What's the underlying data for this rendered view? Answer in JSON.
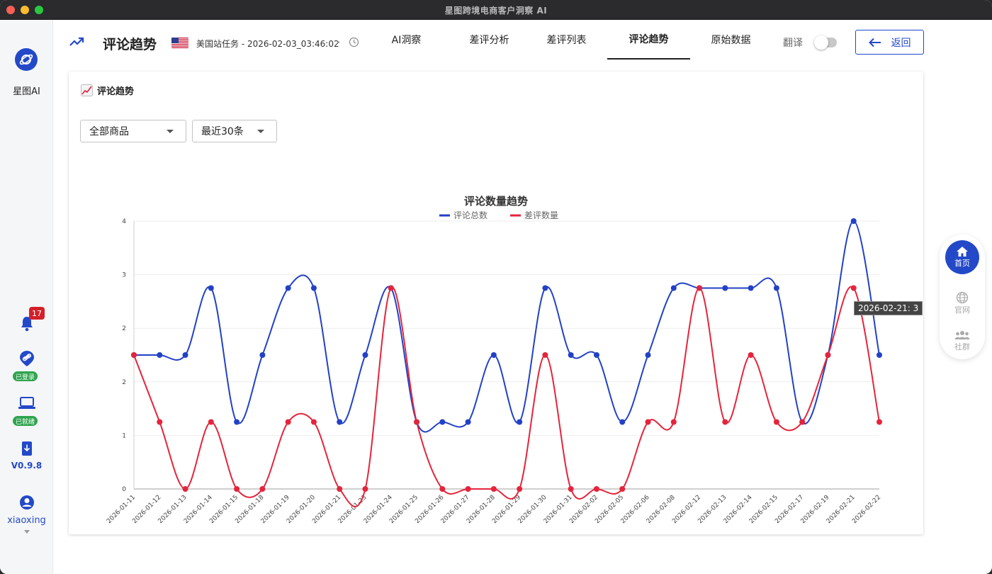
{
  "window": {
    "title": "星图跨境电商客户洞察 AI"
  },
  "sidebar": {
    "brand": "星图AI",
    "notifications": "17",
    "login_status": "已登录",
    "ready_status": "已就绪",
    "version": "V0.9.8",
    "user": "xiaoxing"
  },
  "header": {
    "title": "评论趋势",
    "task": "美国站任务 - 2026-02-03_03:46:02",
    "tabs": [
      {
        "label": "AI洞察",
        "active": false
      },
      {
        "label": "差评分析",
        "active": false
      },
      {
        "label": "差评列表",
        "active": false
      },
      {
        "label": "评论趋势",
        "active": true
      },
      {
        "label": "原始数据",
        "active": false
      }
    ],
    "translate_label": "翻译",
    "translate_on": false,
    "back_label": "返回"
  },
  "card": {
    "title": "评论趋势",
    "product_filter": "全部商品",
    "range_filter": "最近30条"
  },
  "float_panel": {
    "home": "首页",
    "official": "官网",
    "community": "社群"
  },
  "tooltip": "2026-02-21: 3",
  "colors": {
    "accent": "#2349c8",
    "total": "#2241c7",
    "negative": "#e5243b"
  },
  "chart_data": {
    "type": "line",
    "title": "评论数量趋势",
    "categories": [
      "2026-01-11",
      "2026-01-12",
      "2026-01-13",
      "2026-01-14",
      "2026-01-15",
      "2026-01-18",
      "2026-01-19",
      "2026-01-20",
      "2026-01-21",
      "2026-01-23",
      "2026-01-24",
      "2026-01-25",
      "2026-01-26",
      "2026-01-27",
      "2026-01-28",
      "2026-01-29",
      "2026-01-30",
      "2026-01-31",
      "2026-02-02",
      "2026-02-05",
      "2026-02-06",
      "2026-02-08",
      "2026-02-12",
      "2026-02-13",
      "2026-02-14",
      "2026-02-15",
      "2026-02-17",
      "2026-02-19",
      "2026-02-21",
      "2026-02-22"
    ],
    "y_ticks": [
      "0",
      "1",
      "2",
      "2",
      "3",
      "4"
    ],
    "ylim": [
      0,
      4
    ],
    "legend_position": "top-center",
    "grid": true,
    "series": [
      {
        "name": "评论总数",
        "color": "#2241c7",
        "values": [
          2,
          2,
          2,
          3,
          1,
          2,
          3,
          3,
          1,
          2,
          3,
          1,
          1,
          1,
          2,
          1,
          3,
          2,
          2,
          1,
          2,
          3,
          3,
          3,
          3,
          3,
          1,
          2,
          4,
          2
        ]
      },
      {
        "name": "差评数量",
        "color": "#e5243b",
        "values": [
          2,
          1,
          0,
          1,
          0,
          0,
          1,
          1,
          0,
          0,
          3,
          1,
          0,
          0,
          0,
          0,
          2,
          0,
          0,
          0,
          1,
          1,
          3,
          1,
          2,
          1,
          1,
          2,
          3,
          1
        ]
      }
    ]
  }
}
